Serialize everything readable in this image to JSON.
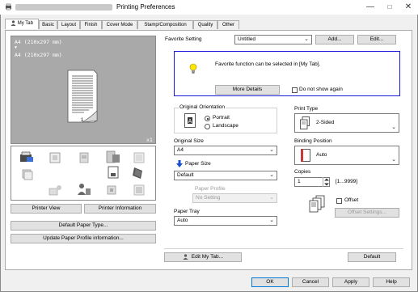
{
  "window": {
    "title": "Printing Preferences"
  },
  "tabs": [
    {
      "label": "My Tab"
    },
    {
      "label": "Basic"
    },
    {
      "label": "Layout"
    },
    {
      "label": "Finish"
    },
    {
      "label": "Cover Mode"
    },
    {
      "label": "Stamp/Composition"
    },
    {
      "label": "Quality"
    },
    {
      "label": "Other"
    }
  ],
  "preview": {
    "line1": "A4 (210x297 mm)",
    "arrow": "▼",
    "line2": "A4 (210x297 mm)",
    "copies_badge": "x1",
    "page_number": "1"
  },
  "left_buttons": {
    "printer_view": "Printer View",
    "printer_information": "Printer Information",
    "default_paper_type": "Default Paper Type...",
    "update_paper_profile": "Update Paper Profile information..."
  },
  "favorite": {
    "label": "Favorite Setting",
    "value": "Untitled",
    "add": "Add...",
    "edit": "Edit..."
  },
  "info": {
    "message": "Favorite function can be selected in [My Tab].",
    "more_details": "More Details",
    "do_not_show": "Do not show again"
  },
  "orientation": {
    "label": "Original Orientation",
    "portrait": "Portrait",
    "landscape": "Landscape",
    "selected": "Portrait"
  },
  "original_size": {
    "label": "Original Size",
    "value": "A4"
  },
  "paper_size": {
    "label": "Paper Size",
    "value": "Default"
  },
  "paper_profile": {
    "label": "Paper Profile",
    "value": "No Setting"
  },
  "paper_tray": {
    "label": "Paper Tray",
    "value": "Auto"
  },
  "print_type": {
    "label": "Print Type",
    "value": "2-Sided"
  },
  "binding_position": {
    "label": "Binding Position",
    "value": "Auto"
  },
  "copies": {
    "label": "Copies",
    "value": "1",
    "range": "[1...9999]"
  },
  "offset": {
    "label": "Offset",
    "settings": "Offset Settings..."
  },
  "bottom_panel": {
    "edit_my_tab": "Edit My Tab...",
    "default": "Default"
  },
  "dialog_buttons": {
    "ok": "OK",
    "cancel": "Cancel",
    "apply": "Apply",
    "help": "Help"
  },
  "colors": {
    "info_border": "#1a1ae0",
    "preview_bg": "#a9a9a9",
    "panel_bg": "#ffffff",
    "window_bg": "#f0f0f0"
  }
}
